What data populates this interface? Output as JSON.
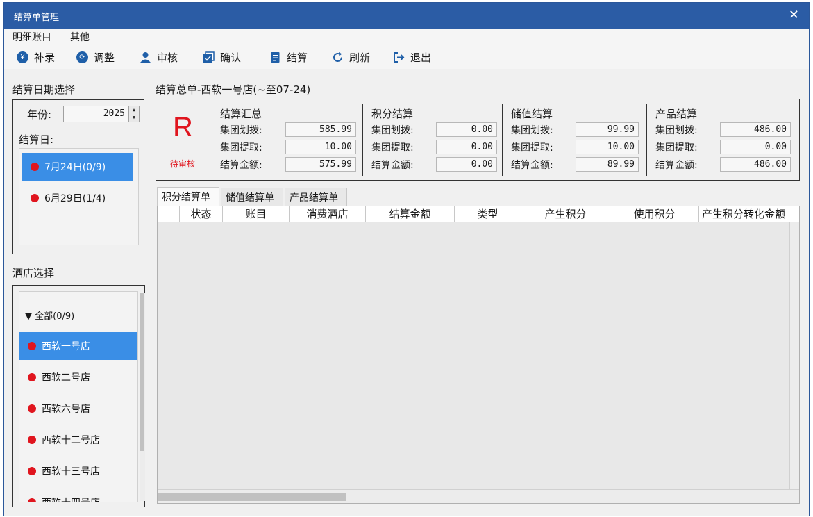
{
  "window": {
    "title": "结算单管理",
    "close": "✕"
  },
  "menu": {
    "items": [
      "明细账目",
      "其他"
    ]
  },
  "toolbar": {
    "buttons": [
      {
        "label": "补录",
        "icon": "yen-circle-icon"
      },
      {
        "label": "调整",
        "icon": "adjust-circle-icon"
      },
      {
        "label": "审核",
        "icon": "user-icon"
      },
      {
        "label": "确认",
        "icon": "confirm-icon"
      },
      {
        "label": "结算",
        "icon": "document-icon"
      },
      {
        "label": "刷新",
        "icon": "refresh-icon"
      },
      {
        "label": "退出",
        "icon": "exit-icon"
      }
    ]
  },
  "left": {
    "date_section_label": "结算日期选择",
    "year_label": "年份:",
    "year_value": "2025",
    "settle_day_label": "结算日:",
    "dates": [
      {
        "label": "7月24日(0/9)",
        "selected": true
      },
      {
        "label": "6月29日(1/4)",
        "selected": false
      }
    ],
    "hotel_section_label": "酒店选择",
    "hotel_root": "▼ 全部(0/9)",
    "hotels": [
      {
        "label": "西软一号店",
        "selected": true
      },
      {
        "label": "西软二号店",
        "selected": false
      },
      {
        "label": "西软六号店",
        "selected": false
      },
      {
        "label": "西软十二号店",
        "selected": false
      },
      {
        "label": "西软十三号店",
        "selected": false
      },
      {
        "label": "西软十四号店",
        "selected": false
      }
    ]
  },
  "summary": {
    "header": "结算总单-西软一号店(~至07-24)",
    "status_letter": "R",
    "status_text": "待审核",
    "columns": [
      {
        "title": "结算汇总",
        "rows": [
          {
            "label": "集团划拨:",
            "value": "585.99"
          },
          {
            "label": "集团提取:",
            "value": "10.00"
          },
          {
            "label": "结算金额:",
            "value": "575.99"
          }
        ]
      },
      {
        "title": "积分结算",
        "rows": [
          {
            "label": "集团划拨:",
            "value": "0.00"
          },
          {
            "label": "集团提取:",
            "value": "0.00"
          },
          {
            "label": "结算金额:",
            "value": "0.00"
          }
        ]
      },
      {
        "title": "储值结算",
        "rows": [
          {
            "label": "集团划拨:",
            "value": "99.99"
          },
          {
            "label": "集团提取:",
            "value": "10.00"
          },
          {
            "label": "结算金额:",
            "value": "89.99"
          }
        ]
      },
      {
        "title": "产品结算",
        "rows": [
          {
            "label": "集团划拨:",
            "value": "486.00"
          },
          {
            "label": "集团提取:",
            "value": "0.00"
          },
          {
            "label": "结算金额:",
            "value": "486.00"
          }
        ]
      }
    ]
  },
  "tabs": [
    {
      "label": "积分结算单",
      "active": true
    },
    {
      "label": "储值结算单",
      "active": false
    },
    {
      "label": "产品结算单",
      "active": false
    }
  ],
  "grid": {
    "columns": [
      "",
      "状态",
      "账目",
      "消费酒店",
      "结算金额",
      "类型",
      "产生积分",
      "使用积分",
      "产生积分转化金额"
    ]
  },
  "colors": {
    "titlebar": "#2b5ca5",
    "selection": "#3a8ee6",
    "status_red": "#e0151e"
  }
}
